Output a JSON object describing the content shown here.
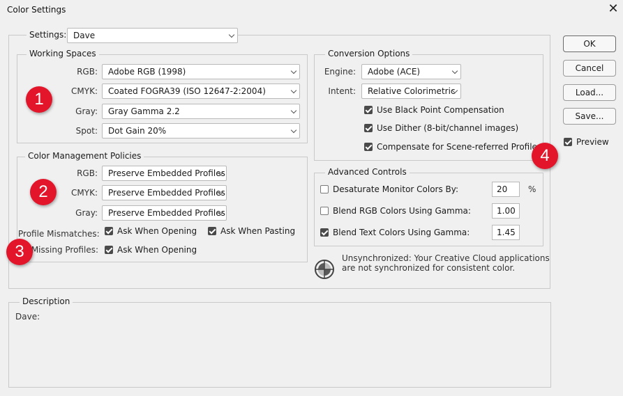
{
  "window": {
    "title": "Color Settings",
    "close_icon": "close-icon"
  },
  "settings": {
    "label": "Settings:",
    "value": "Dave"
  },
  "working_spaces": {
    "legend": "Working Spaces",
    "rgb": {
      "label": "RGB:",
      "value": "Adobe RGB (1998)"
    },
    "cmyk": {
      "label": "CMYK:",
      "value": "Coated FOGRA39 (ISO 12647-2:2004)"
    },
    "gray": {
      "label": "Gray:",
      "value": "Gray Gamma 2.2"
    },
    "spot": {
      "label": "Spot:",
      "value": "Dot Gain 20%"
    }
  },
  "policies": {
    "legend": "Color Management Policies",
    "rgb": {
      "label": "RGB:",
      "value": "Preserve Embedded Profiles"
    },
    "cmyk": {
      "label": "CMYK:",
      "value": "Preserve Embedded Profiles"
    },
    "gray": {
      "label": "Gray:",
      "value": "Preserve Embedded Profiles"
    },
    "profile_mismatches": {
      "label": "Profile Mismatches:",
      "ask_opening": {
        "label": "Ask When Opening",
        "checked": true
      },
      "ask_pasting": {
        "label": "Ask When Pasting",
        "checked": true
      }
    },
    "missing_profiles": {
      "label": "Missing Profiles:",
      "ask_opening": {
        "label": "Ask When Opening",
        "checked": true
      }
    }
  },
  "conversion": {
    "legend": "Conversion Options",
    "engine": {
      "label": "Engine:",
      "value": "Adobe (ACE)"
    },
    "intent": {
      "label": "Intent:",
      "value": "Relative Colorimetric"
    },
    "black_point": {
      "label": "Use Black Point Compensation",
      "checked": true
    },
    "dither": {
      "label": "Use Dither (8-bit/channel images)",
      "checked": true
    },
    "scene_referred": {
      "label": "Compensate for Scene-referred Profiles",
      "checked": true
    }
  },
  "advanced": {
    "legend": "Advanced Controls",
    "desaturate": {
      "label": "Desaturate Monitor Colors By:",
      "value": "20",
      "unit": "%",
      "checked": false
    },
    "blend_rgb": {
      "label": "Blend RGB Colors Using Gamma:",
      "value": "1.00",
      "checked": false
    },
    "blend_text": {
      "label": "Blend Text Colors Using Gamma:",
      "value": "1.45",
      "checked": true
    }
  },
  "sync": {
    "line1": "Unsynchronized: Your Creative Cloud applications",
    "line2": "are not synchronized for consistent color.",
    "icon": "sync-status-icon"
  },
  "description": {
    "legend": "Description",
    "text": "Dave:"
  },
  "buttons": {
    "ok": "OK",
    "cancel": "Cancel",
    "load": "Load...",
    "save": "Save..."
  },
  "preview": {
    "label": "Preview",
    "checked": true
  },
  "annotations": [
    "1",
    "2",
    "3",
    "4"
  ],
  "colors": {
    "badge": "#e3152b",
    "background": "#f0f0f0"
  }
}
